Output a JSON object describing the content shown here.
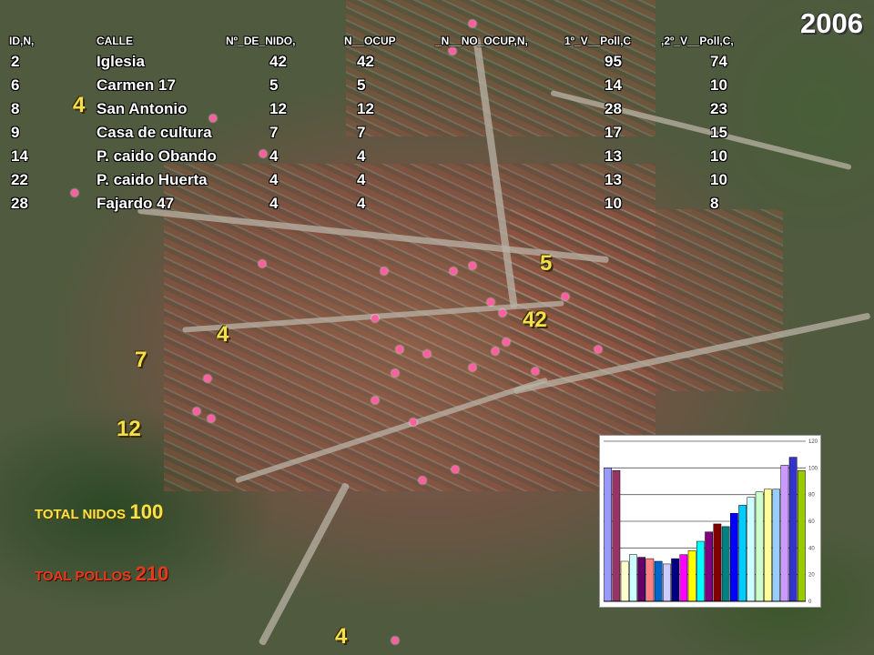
{
  "year": "2006",
  "table": {
    "headers": [
      "ID,N,",
      "CALLE",
      "Nº_DE_NIDO,",
      "N__OCUP",
      "_N__NO_OCUP,N,",
      "1º_V__Poll,C",
      ",2º_V__Poll,C,"
    ],
    "rows": [
      [
        "2",
        "Iglesia",
        "42",
        "42",
        "",
        "95",
        "74"
      ],
      [
        "6",
        "Carmen  17",
        "5",
        "5",
        "",
        "14",
        "10"
      ],
      [
        "8",
        "San Antonio",
        "12",
        "12",
        "",
        "28",
        "23"
      ],
      [
        "9",
        "Casa de cultura",
        "7",
        "7",
        "",
        "17",
        "15"
      ],
      [
        "14",
        "P. caido Obando",
        "4",
        "4",
        "",
        "13",
        "10"
      ],
      [
        "22",
        "P. caido Huerta",
        "4",
        "4",
        "",
        "13",
        "10"
      ],
      [
        "28",
        "Fajardo  47",
        "4",
        "4",
        "",
        "10",
        "8"
      ]
    ]
  },
  "map_labels": [
    "4",
    "5",
    "42",
    "4",
    "7",
    "12",
    "4"
  ],
  "totals": {
    "nidos_label": "TOTAL NIDOS",
    "nidos_value": "100",
    "pollos_label": "TOAL POLLOS",
    "pollos_value": "210"
  },
  "colors": {
    "label_yellow": "#f4e04a",
    "totals_yellow": "#f2e44b",
    "totals_red": "#e53a1c",
    "nest_dot": "#ff5fa2"
  },
  "chart_data": {
    "type": "bar",
    "values": [
      100,
      98,
      30,
      35,
      33,
      32,
      30,
      28,
      32,
      35,
      38,
      45,
      52,
      58,
      56,
      66,
      72,
      78,
      82,
      84,
      84,
      102,
      108,
      98
    ],
    "colors": [
      "#9999ff",
      "#993366",
      "#ffffcc",
      "#ccffff",
      "#660066",
      "#ff8080",
      "#0066cc",
      "#ccccff",
      "#000080",
      "#ff00ff",
      "#ffff00",
      "#00ffff",
      "#800080",
      "#800000",
      "#008080",
      "#0000ff",
      "#00ccff",
      "#ccffff",
      "#ccffcc",
      "#ffff99",
      "#99ccff",
      "#cc99ff",
      "#3333cc",
      "#99cc00"
    ],
    "ylim": [
      0,
      120
    ],
    "yticks": [
      "0",
      "20",
      "40",
      "60",
      "80",
      "100",
      "120"
    ],
    "grid": true,
    "title": "",
    "xlabel": "",
    "ylabel": ""
  }
}
